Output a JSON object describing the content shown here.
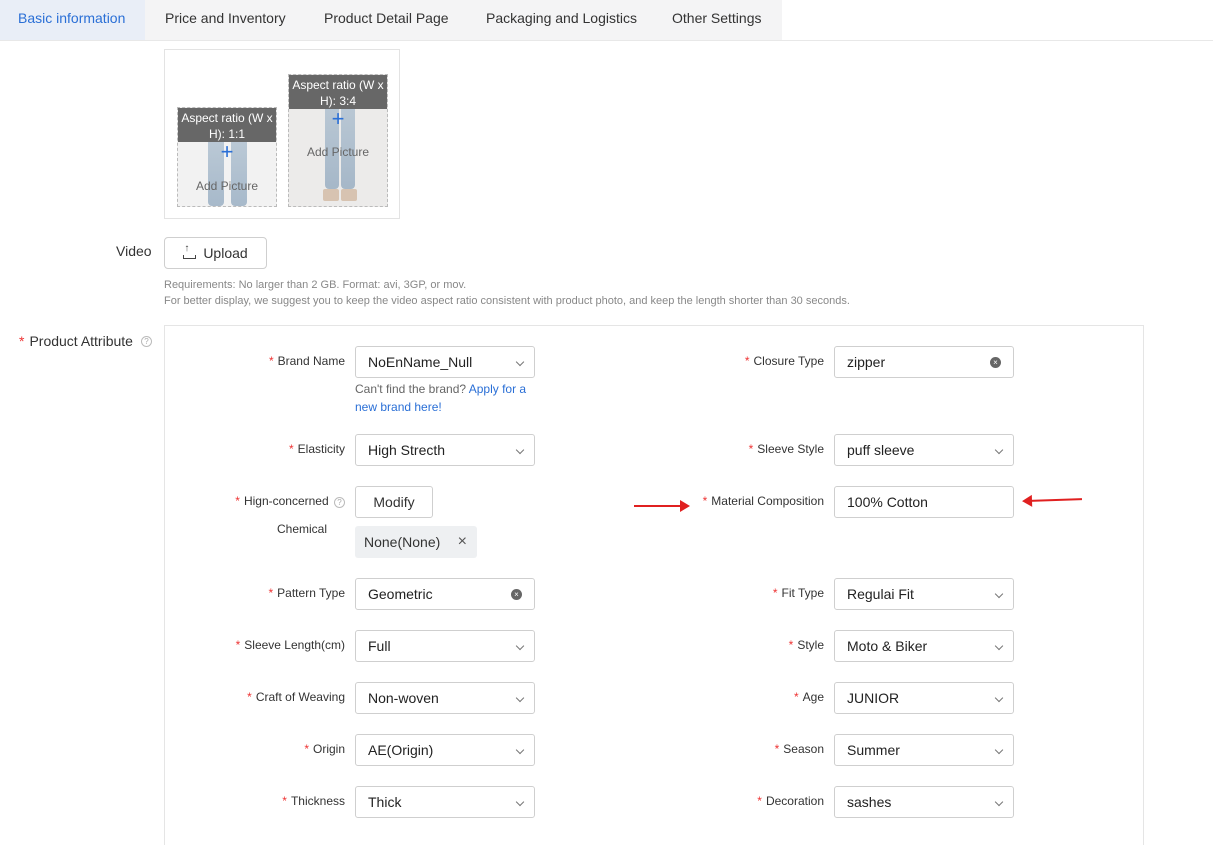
{
  "tabs": [
    "Basic information",
    "Price and Inventory",
    "Product Detail Page",
    "Packaging and Logistics",
    "Other Settings"
  ],
  "pictures": {
    "square": {
      "label": "Aspect ratio (W x H): 1:1",
      "add": "Add Picture"
    },
    "portrait": {
      "label": "Aspect ratio (W x H): 3:4",
      "add": "Add Picture"
    }
  },
  "video": {
    "label": "Video",
    "upload": "Upload",
    "req1": "Requirements: No larger than 2 GB. Format: avi, 3GP, or mov.",
    "req2": "For better display, we suggest you to keep the video aspect ratio consistent with product photo, and keep the length shorter than 30 seconds."
  },
  "product_attribute": {
    "label": "Product Attribute"
  },
  "fields": {
    "brand": {
      "label": "Brand Name",
      "value": "NoEnName_Null",
      "hint": "Can't find the brand?",
      "hint_link": "Apply for a new brand here!"
    },
    "closure": {
      "label": "Closure Type",
      "value": "zipper"
    },
    "elasticity": {
      "label": "Elasticity",
      "value": "High Strecth"
    },
    "sleeve_style": {
      "label": "Sleeve Style",
      "value": "puff sleeve"
    },
    "chemical": {
      "label1": "Hign-concerned",
      "label2": "Chemical",
      "button": "Modify",
      "chip": "None(None)"
    },
    "material": {
      "label": "Material Composition",
      "value": "100% Cotton"
    },
    "pattern": {
      "label": "Pattern Type",
      "value": "Geometric"
    },
    "fit": {
      "label": "Fit Type",
      "value": "Regulai Fit"
    },
    "sleeve_length": {
      "label": "Sleeve Length(cm)",
      "value": "Full"
    },
    "style": {
      "label": "Style",
      "value": "Moto & Biker"
    },
    "weaving": {
      "label": "Craft of Weaving",
      "value": "Non-woven"
    },
    "age": {
      "label": "Age",
      "value": "JUNIOR"
    },
    "origin": {
      "label": "Origin",
      "value": "AE(Origin)"
    },
    "season": {
      "label": "Season",
      "value": "Summer"
    },
    "thickness": {
      "label": "Thickness",
      "value": "Thick"
    },
    "decoration": {
      "label": "Decoration",
      "value": "sashes"
    }
  },
  "symbols": {
    "star": "*",
    "plus": "+",
    "clear": "×",
    "question": "?"
  },
  "colors": {
    "accent": "#2a6fd6",
    "required": "#e33333",
    "annotation_arrow": "#e02020"
  }
}
